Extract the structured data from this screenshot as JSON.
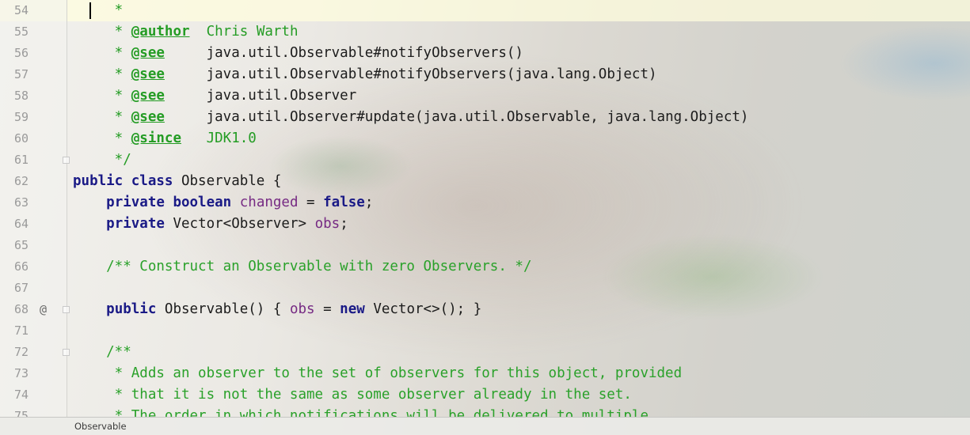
{
  "editor": {
    "lines": [
      {
        "num": "54",
        "parts": [
          {
            "t": "     *",
            "c": "doc"
          }
        ]
      },
      {
        "num": "55",
        "parts": [
          {
            "t": "     * ",
            "c": "doc"
          },
          {
            "t": "@author",
            "c": "tag"
          },
          {
            "t": "  Chris Warth",
            "c": "doc"
          }
        ]
      },
      {
        "num": "56",
        "parts": [
          {
            "t": "     * ",
            "c": "doc"
          },
          {
            "t": "@see",
            "c": "tag"
          },
          {
            "t": "     java.util.Observable#notifyObservers()",
            "c": ""
          }
        ]
      },
      {
        "num": "57",
        "parts": [
          {
            "t": "     * ",
            "c": "doc"
          },
          {
            "t": "@see",
            "c": "tag"
          },
          {
            "t": "     java.util.Observable#notifyObservers(java.lang.Object)",
            "c": ""
          }
        ]
      },
      {
        "num": "58",
        "parts": [
          {
            "t": "     * ",
            "c": "doc"
          },
          {
            "t": "@see",
            "c": "tag"
          },
          {
            "t": "     java.util.Observer",
            "c": ""
          }
        ]
      },
      {
        "num": "59",
        "parts": [
          {
            "t": "     * ",
            "c": "doc"
          },
          {
            "t": "@see",
            "c": "tag"
          },
          {
            "t": "     java.util.Observer#update(java.util.Observable, java.lang.Object)",
            "c": ""
          }
        ]
      },
      {
        "num": "60",
        "parts": [
          {
            "t": "     * ",
            "c": "doc"
          },
          {
            "t": "@since",
            "c": "tag"
          },
          {
            "t": "   JDK1.0",
            "c": "doc"
          }
        ]
      },
      {
        "num": "61",
        "parts": [
          {
            "t": "     */",
            "c": "doc"
          }
        ]
      },
      {
        "num": "62",
        "parts": [
          {
            "t": "public class",
            "c": "kw"
          },
          {
            "t": " Observable {",
            "c": ""
          }
        ]
      },
      {
        "num": "63",
        "parts": [
          {
            "t": "    ",
            "c": ""
          },
          {
            "t": "private boolean",
            "c": "kw"
          },
          {
            "t": " ",
            "c": ""
          },
          {
            "t": "changed",
            "c": "field"
          },
          {
            "t": " = ",
            "c": ""
          },
          {
            "t": "false",
            "c": "kw"
          },
          {
            "t": ";",
            "c": ""
          }
        ]
      },
      {
        "num": "64",
        "parts": [
          {
            "t": "    ",
            "c": ""
          },
          {
            "t": "private",
            "c": "kw"
          },
          {
            "t": " Vector<Observer> ",
            "c": ""
          },
          {
            "t": "obs",
            "c": "field"
          },
          {
            "t": ";",
            "c": ""
          }
        ]
      },
      {
        "num": "65",
        "parts": []
      },
      {
        "num": "66",
        "parts": [
          {
            "t": "    /** Construct an Observable with zero Observers. */",
            "c": "cmt"
          }
        ]
      },
      {
        "num": "67",
        "parts": []
      },
      {
        "num": "68",
        "mark": "@",
        "parts": [
          {
            "t": "    ",
            "c": ""
          },
          {
            "t": "public",
            "c": "kw"
          },
          {
            "t": " Observable() { ",
            "c": ""
          },
          {
            "t": "obs",
            "c": "field"
          },
          {
            "t": " = ",
            "c": ""
          },
          {
            "t": "new",
            "c": "kw"
          },
          {
            "t": " Vector<>(); }",
            "c": ""
          }
        ]
      },
      {
        "num": "71",
        "parts": []
      },
      {
        "num": "72",
        "parts": [
          {
            "t": "    /**",
            "c": "cmt"
          }
        ]
      },
      {
        "num": "73",
        "parts": [
          {
            "t": "     * Adds an observer to the set of observers for this object, provided",
            "c": "cmt"
          }
        ]
      },
      {
        "num": "74",
        "parts": [
          {
            "t": "     * that it is not the same as some observer already in the set.",
            "c": "cmt"
          }
        ]
      },
      {
        "num": "75",
        "parts": [
          {
            "t": "     * The order in which notifications will be delivered to multiple",
            "c": "cmt"
          }
        ]
      }
    ]
  },
  "statusbar": {
    "breadcrumb": "Observable"
  }
}
